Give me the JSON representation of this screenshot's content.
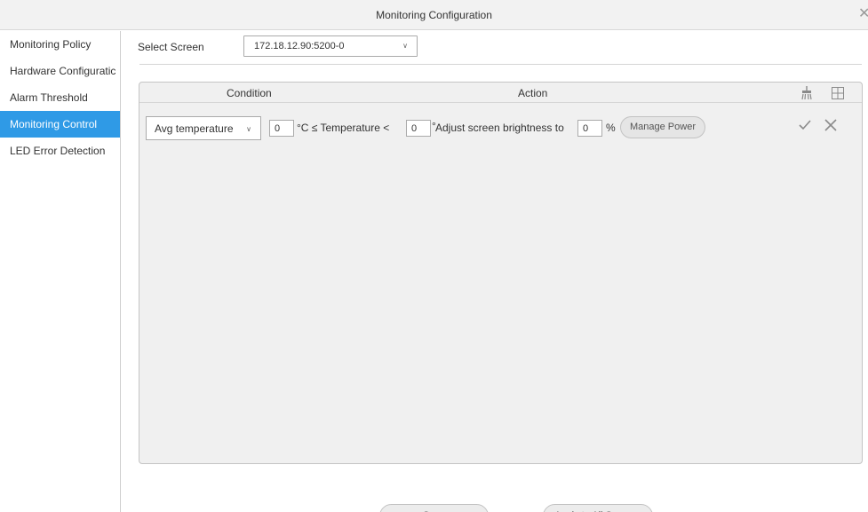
{
  "window": {
    "title": "Monitoring Configuration"
  },
  "sidebar": {
    "items": [
      {
        "label": "Monitoring Policy",
        "active": false
      },
      {
        "label": "Hardware Configuratic",
        "active": false
      },
      {
        "label": "Alarm Threshold",
        "active": false
      },
      {
        "label": "Monitoring Control",
        "active": true
      },
      {
        "label": "LED Error Detection",
        "active": false
      }
    ]
  },
  "screen": {
    "label": "Select Screen",
    "selected": "172.18.12.90:5200-0"
  },
  "table": {
    "headers": {
      "condition": "Condition",
      "action": "Action"
    },
    "row": {
      "condition_select": "Avg temperature",
      "min_value": "0",
      "range_text": "°C ≤ Temperature <",
      "max_value": "0",
      "unit_mark": "°",
      "action_text": "Adjust screen brightness to",
      "brightness_value": "0",
      "percent": "%",
      "manage_power_label": "Manage Power"
    }
  },
  "footer": {
    "save_label": "Save",
    "apply_label": "Apply to All Screens"
  },
  "colors": {
    "accent": "#2f9ae6",
    "panel_bg": "#f0f0f0"
  },
  "icons": [
    "close-icon",
    "chevron-down-icon",
    "broom-icon",
    "add-grid-icon",
    "check-icon",
    "x-icon"
  ]
}
